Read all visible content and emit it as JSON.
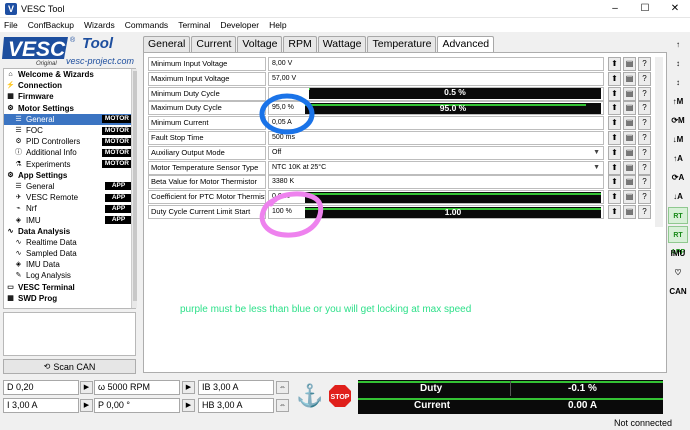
{
  "window": {
    "title": "VESC Tool"
  },
  "menu": [
    "File",
    "ConfBackup",
    "Wizards",
    "Commands",
    "Terminal",
    "Developer",
    "Help"
  ],
  "logo": {
    "brand": "VESC",
    "suffix": "Tool",
    "tag": "Original",
    "url": "vesc-project.com"
  },
  "sidebar": {
    "items": [
      {
        "label": "Welcome & Wizards",
        "header": true,
        "icon": "home-icon"
      },
      {
        "label": "Connection",
        "header": true,
        "icon": "plug-icon"
      },
      {
        "label": "Firmware",
        "header": true,
        "icon": "chip-icon"
      },
      {
        "label": "Motor Settings",
        "header": true,
        "icon": "motor-icon"
      },
      {
        "label": "General",
        "badge": "MOTOR",
        "selected": true,
        "icon": "sliders-icon"
      },
      {
        "label": "FOC",
        "badge": "MOTOR",
        "icon": "sliders-icon"
      },
      {
        "label": "PID Controllers",
        "badge": "MOTOR",
        "icon": "gear-icon"
      },
      {
        "label": "Additional Info",
        "badge": "MOTOR",
        "icon": "info-icon"
      },
      {
        "label": "Experiments",
        "badge": "MOTOR",
        "icon": "flask-icon"
      },
      {
        "label": "App Settings",
        "header": true,
        "icon": "gear-icon"
      },
      {
        "label": "General",
        "badge": "APP",
        "icon": "sliders-icon"
      },
      {
        "label": "VESC Remote",
        "badge": "APP",
        "icon": "remote-icon"
      },
      {
        "label": "Nrf",
        "badge": "APP",
        "icon": "radio-icon"
      },
      {
        "label": "IMU",
        "badge": "APP",
        "icon": "imu-icon"
      },
      {
        "label": "Data Analysis",
        "header": true,
        "icon": "chart-icon"
      },
      {
        "label": "Realtime Data",
        "icon": "chart-icon"
      },
      {
        "label": "Sampled Data",
        "icon": "chart-icon"
      },
      {
        "label": "IMU Data",
        "icon": "imu-icon"
      },
      {
        "label": "Log Analysis",
        "icon": "log-icon"
      },
      {
        "label": "VESC Terminal",
        "header": true,
        "icon": "terminal-icon"
      },
      {
        "label": "SWD Prog",
        "header": true,
        "icon": "chip-icon"
      }
    ]
  },
  "scan_can_label": "Scan CAN",
  "tabs": [
    "General",
    "Current",
    "Voltage",
    "RPM",
    "Wattage",
    "Temperature",
    "Advanced"
  ],
  "active_tab": "Advanced",
  "params": [
    {
      "label": "Minimum Input Voltage",
      "value": "8,00 V"
    },
    {
      "label": "Maximum Input Voltage",
      "value": "57,00 V"
    },
    {
      "label": "Minimum Duty Cycle",
      "value": "",
      "bar_text": "0.5 %",
      "bar_fraction": 0.005
    },
    {
      "label": "Maximum Duty Cycle",
      "value": "95,0 %",
      "bar_text": "95.0 %",
      "bar_fraction": 0.95
    },
    {
      "label": "Minimum Current",
      "value": "0,05 A"
    },
    {
      "label": "Fault Stop Time",
      "value": "500 ms"
    },
    {
      "label": "Auxiliary Output Mode",
      "value": "Off",
      "combo": true
    },
    {
      "label": "Motor Temperature Sensor Type",
      "value": "NTC 10K at 25°C",
      "combo": true
    },
    {
      "label": "Beta Value for Motor Thermistor",
      "value": "3380 K"
    },
    {
      "label": "Coefficient for PTC Motor Thermistor",
      "value": "0,0 %",
      "bar_fraction": 1.0
    },
    {
      "label": "Duty Cycle Current Limit Start",
      "value": "100 %",
      "bar_text": "1.00",
      "bar_fraction": 1.0
    }
  ],
  "annotation": "purple must be less than blue or you will get locking at max speed",
  "colors": {
    "annotation_text": "#2ee08a",
    "blue_circle": "#1a73e8",
    "pink_circle": "#ee82ee",
    "bar_fill": "#34c234",
    "selected": "#3b74c2"
  },
  "right_toolbar": [
    "↑",
    "↕",
    "↕",
    "↑M",
    "⟳M",
    "↓M",
    "↑A",
    "⟳A",
    "↓A",
    "RT",
    "RT APP",
    "IMU",
    "♡",
    "CAN"
  ],
  "bottom": {
    "d": "D 0,20",
    "i": "I 3,00 A",
    "rpm": "ω 5000 RPM",
    "p": "P 0,00 °",
    "ib": "IB 3,00 A",
    "hb": "HB 3,00 A",
    "stop_label": "STOP",
    "duty_label": "Duty",
    "duty_value": "-0.1 %",
    "current_label": "Current",
    "current_value": "0.00 A"
  },
  "status": "Not connected"
}
